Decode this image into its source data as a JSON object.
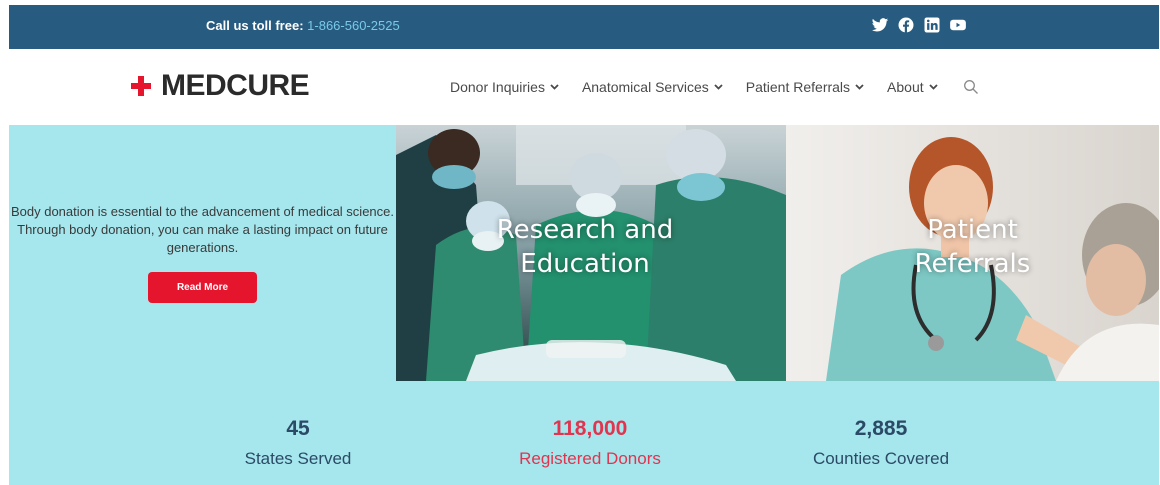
{
  "topbar": {
    "call_label": "Call us toll free:",
    "phone": "1-866-560-2525",
    "social": [
      "twitter-icon",
      "facebook-icon",
      "linkedin-icon",
      "youtube-icon"
    ],
    "background": "#275b7f",
    "phone_color": "#79c9e8"
  },
  "header": {
    "logo_text": "MEDCURE",
    "logo_color": "#e5152d",
    "nav": [
      {
        "label": "Donor Inquiries"
      },
      {
        "label": "Anatomical Services"
      },
      {
        "label": "Patient Referrals"
      },
      {
        "label": "About"
      }
    ],
    "search_icon": "search-icon"
  },
  "hero": {
    "intro_text": "Body donation is essential to the advancement of medical science. Through body donation, you can make a lasting impact on future generations.",
    "button_label": "Read More",
    "background": "#a6e6ed",
    "button_color": "#e5152d",
    "panels": [
      {
        "line1": "Research and",
        "line2": "Education"
      },
      {
        "line1": "Patient",
        "line2": "Referrals"
      }
    ]
  },
  "stats": [
    {
      "value": "45",
      "label": "States Served"
    },
    {
      "value": "118,000",
      "label": "Registered Donors"
    },
    {
      "value": "2,885",
      "label": "Counties Covered"
    }
  ]
}
